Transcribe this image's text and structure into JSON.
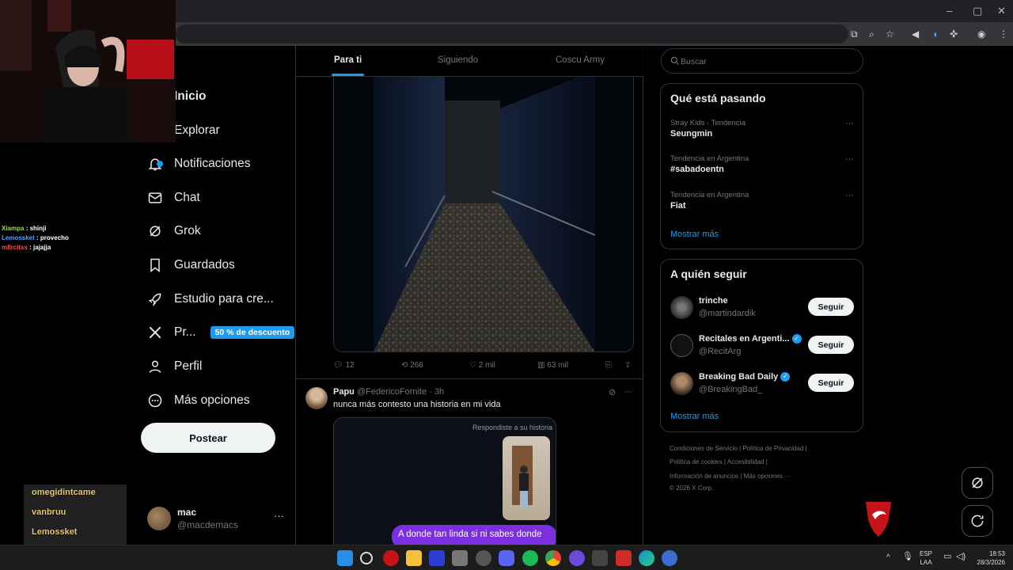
{
  "tabs": [
    "Para ti",
    "Siguiendo",
    "Coscu Army"
  ],
  "nav": [
    {
      "label": "Inicio",
      "icon": "home-icon"
    },
    {
      "label": "Explorar",
      "icon": "search-icon"
    },
    {
      "label": "Notificaciones",
      "icon": "bell-icon"
    },
    {
      "label": "Chat",
      "icon": "mail-icon"
    },
    {
      "label": "Grok",
      "icon": "grok-icon"
    },
    {
      "label": "Guardados",
      "icon": "bookmark-icon"
    },
    {
      "label": "Estudio para cre...",
      "icon": "rocket-icon"
    },
    {
      "label": "Pr...",
      "icon": "x-logo-icon",
      "badge": "50 % de descuento"
    },
    {
      "label": "Perfil",
      "icon": "user-icon"
    },
    {
      "label": "Más opciones",
      "icon": "more-circle-icon"
    }
  ],
  "post_button": "Postear",
  "account": {
    "name": "mac",
    "handle": "@macdemacs",
    "more": "···"
  },
  "post1": {
    "replies": "12",
    "reposts": "268",
    "likes": "2 mil",
    "views": "63 mil"
  },
  "post2": {
    "name": "Papu",
    "handle": "@FedericoFornite · 3h",
    "text": "nunca más contesto una historia en mi vida",
    "story_label": "Respondiste a su historia",
    "reply_text": "A donde tan linda si ni sabes donde"
  },
  "search": {
    "placeholder": "Buscar"
  },
  "trending": {
    "title": "Qué está pasando",
    "items": [
      {
        "context": "Stray Kids · Tendencia",
        "name": "Seungmin"
      },
      {
        "context": "Tendencia en Argentina",
        "name": "#sabadoentn"
      },
      {
        "context": "Tendencia en Argentina",
        "name": "Fiat"
      }
    ],
    "show_more": "Mostrar más",
    "dots": "···"
  },
  "who_to_follow": {
    "title": "A quién seguir",
    "items": [
      {
        "name": "trinche",
        "handle": "@martindardik",
        "verified": false,
        "button": "Seguir"
      },
      {
        "name": "Recitales en Argenti...",
        "handle": "@RecitArg",
        "verified": true,
        "button": "Seguir"
      },
      {
        "name": "Breaking Bad Daily",
        "handle": "@BreakingBad_",
        "verified": true,
        "button": "Seguir"
      }
    ],
    "show_more": "Mostrar más"
  },
  "footer": {
    "line1": "Condiciones de Servicio  |  Política de Privacidad  |",
    "line2": "Política de cookies  |  Accesibilidad  |",
    "line3": "Información de anuncios  |  Más opciones ···",
    "line4": "© 2026 X Corp."
  },
  "stream_chat": [
    {
      "user": "Xiampa",
      "message": "shinji"
    },
    {
      "user": "Lemossket",
      "message": "provecho"
    },
    {
      "user": "m8rcitss",
      "message": "jajajja"
    }
  ],
  "stream_followers": [
    "omegidintcame",
    "vanbruu",
    "Lemossket"
  ],
  "system_tray": {
    "lang": "ESP",
    "layout": "LAA",
    "time": "18:53",
    "date": "28/3/2026"
  },
  "colors": {
    "accent": "#1d9bf0",
    "background": "#000000",
    "border": "#2f3336",
    "muted": "#71767b"
  }
}
